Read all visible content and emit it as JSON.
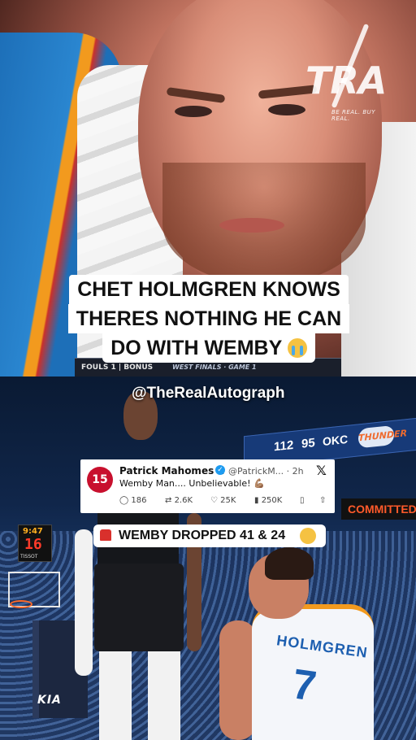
{
  "top_frame": {
    "logo_mark": "TRA",
    "logo_tagline": "BE REAL. BUY REAL.",
    "scorebar_fouls": "FOULS 1 | BONUS",
    "scorebar_game": "WEST FINALS · GAME 1",
    "caption_line1": "CHET HOLMGREN KNOWS",
    "caption_line2": "THERES NOTHING HE CAN",
    "caption_line3": "DO WITH WEMBY",
    "caption_emoji": "sob-emoji"
  },
  "bottom_frame": {
    "watermark_handle": "@TheRealAutograph",
    "scoreboard": {
      "left_score": "112",
      "right_score": "95",
      "team": "OKC",
      "team_logo": "THUNDER"
    },
    "ribbon_text": "COMMITTED",
    "shot_clock": {
      "game_clock": "9:47",
      "shot": "16",
      "sponsor": "TISSOT"
    },
    "arena_sponsor": "KIA",
    "tweet": {
      "avatar_text": "15",
      "author": "Patrick Mahomes II",
      "handle_time": "@PatrickM... · 2h",
      "text": "Wemby Man.... Unbelievable! 💪🏽",
      "replies": "186",
      "reposts": "2.6K",
      "likes": "25K",
      "views": "250K",
      "platform_icon": "x-logo-icon"
    },
    "banner": {
      "text": "WEMBY DROPPED 41 & 24",
      "left_icon": "siren-icon",
      "right_icon": "exploding-head-emoji"
    },
    "jersey_name": "HOLMGREN",
    "jersey_number": "7"
  }
}
